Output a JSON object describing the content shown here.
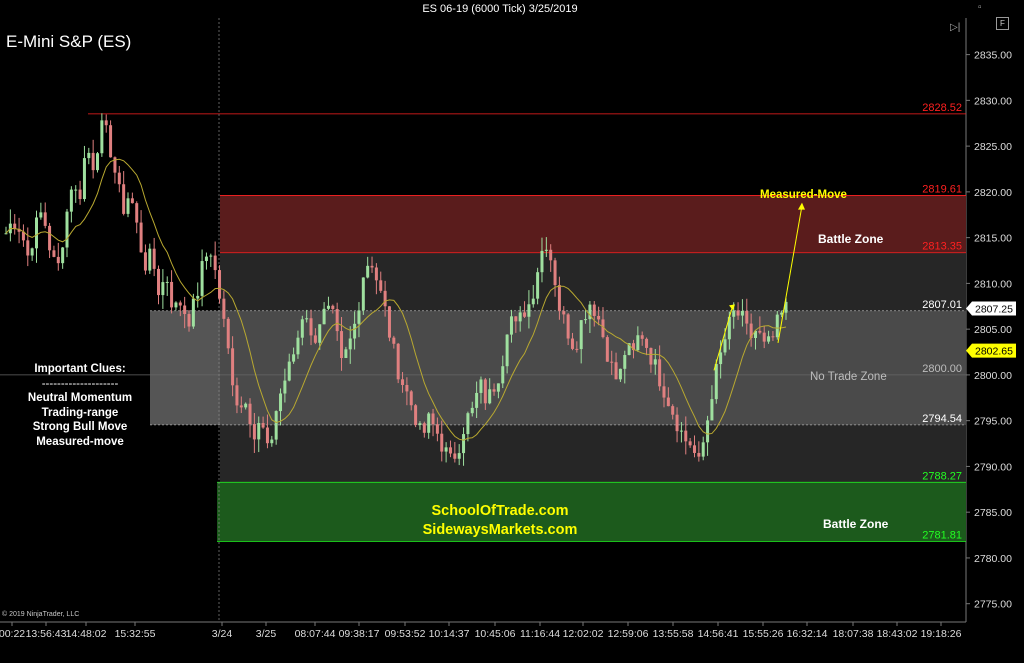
{
  "header": {
    "title": "ES 06-19 (6000 Tick)  3/25/2019",
    "instrument": "E-Mini S&P (ES)",
    "f_button": "F",
    "copyright": "© 2019 NinjaTrader, LLC"
  },
  "clues": {
    "title": "Important Clues:",
    "separator": "--------------------",
    "items": [
      "Neutral Momentum",
      "Trading-range",
      "Strong Bull Move",
      "Measured-move"
    ]
  },
  "watermark": {
    "line1": "SchoolOfTrade.com",
    "line2": "SidewaysMarkets.com"
  },
  "zones": {
    "battle_upper": "Battle Zone",
    "battle_lower": "Battle Zone",
    "no_trade": "No Trade Zone",
    "measured_move": "Measured-Move"
  },
  "chart_data": {
    "type": "candlestick",
    "ylim": [
      2773,
      2839
    ],
    "y_ticks": [
      2775,
      2780,
      2785,
      2790,
      2795,
      2800,
      2805,
      2810,
      2815,
      2820,
      2825,
      2830,
      2835
    ],
    "y_tick_labels": [
      "2775.00",
      "2780.00",
      "2785.00",
      "2790.00",
      "2795.00",
      "2800.00",
      "2805.00",
      "2810.00",
      "2815.00",
      "2820.00",
      "2825.00",
      "2830.00",
      "2835.00"
    ],
    "x_tick_labels": [
      "00:22",
      "13:56:43",
      "14:48:02",
      "15:32:55",
      "3/24",
      "3/25",
      "08:07:44",
      "09:38:17",
      "09:53:52",
      "10:14:37",
      "10:45:06",
      "11:16:44",
      "12:02:02",
      "12:59:06",
      "13:55:58",
      "14:56:41",
      "15:55:26",
      "16:32:14",
      "18:07:38",
      "18:43:02",
      "19:18:26"
    ],
    "levels": [
      {
        "value": 2828.52,
        "label": "2828.52",
        "color": "#ff2020"
      },
      {
        "value": 2819.61,
        "label": "2819.61",
        "color": "#ff2020"
      },
      {
        "value": 2813.35,
        "label": "2813.35",
        "color": "#ff2020"
      },
      {
        "value": 2807.01,
        "label": "2807.01",
        "color": "#ffffff"
      },
      {
        "value": 2800.0,
        "label": "2800.00",
        "color": "#bdbdbd"
      },
      {
        "value": 2794.54,
        "label": "2794.54",
        "color": "#ffffff"
      },
      {
        "value": 2788.27,
        "label": "2788.27",
        "color": "#22ff22"
      },
      {
        "value": 2781.81,
        "label": "2781.81",
        "color": "#22ff22"
      }
    ],
    "bands": [
      {
        "from": 2813.35,
        "to": 2819.61,
        "color": "#5a1c1c"
      },
      {
        "from": 2794.54,
        "to": 2807.01,
        "color": "#555555"
      },
      {
        "from": 2781.81,
        "to": 2788.27,
        "color": "#1c5a1c"
      }
    ],
    "price_tags": [
      {
        "value": 2807.25,
        "label": "2807.25",
        "bg": "#ffffff",
        "fg": "#000000"
      },
      {
        "value": 2802.65,
        "label": "2802.65",
        "bg": "#ffff00",
        "fg": "#000000"
      }
    ],
    "close_path": [
      2815.5,
      2817,
      2816,
      2813,
      2816,
      2818,
      2814,
      2811,
      2816,
      2821,
      2819,
      2825,
      2823,
      2827,
      2826,
      2822,
      2818,
      2820,
      2816,
      2812,
      2813,
      2809,
      2811,
      2807,
      2808,
      2806,
      2808,
      2812,
      2814,
      2810,
      2805,
      2800,
      2796,
      2798,
      2793,
      2795,
      2791,
      2796,
      2799,
      2801,
      2804,
      2808,
      2803,
      2806,
      2807,
      2806,
      2801,
      2803,
      2806,
      2811,
      2813,
      2810,
      2807,
      2803,
      2800,
      2798,
      2796,
      2793,
      2795,
      2794,
      2792,
      2790.5,
      2792,
      2795,
      2796,
      2799,
      2797,
      2799,
      2801,
      2807,
      2805,
      2807,
      2808,
      2812,
      2815,
      2812,
      2807,
      2805,
      2803,
      2806,
      2808,
      2807,
      2804,
      2801,
      2799,
      2803,
      2802,
      2805,
      2803,
      2801,
      2799,
      2797,
      2795,
      2793,
      2792.5,
      2790,
      2794,
      2799,
      2802,
      2805,
      2807,
      2806,
      2804,
      2805,
      2803,
      2803.5,
      2806,
      2807.25
    ],
    "annotation": {
      "text": "Measured-Move",
      "arrow_to": 2818.5
    }
  }
}
